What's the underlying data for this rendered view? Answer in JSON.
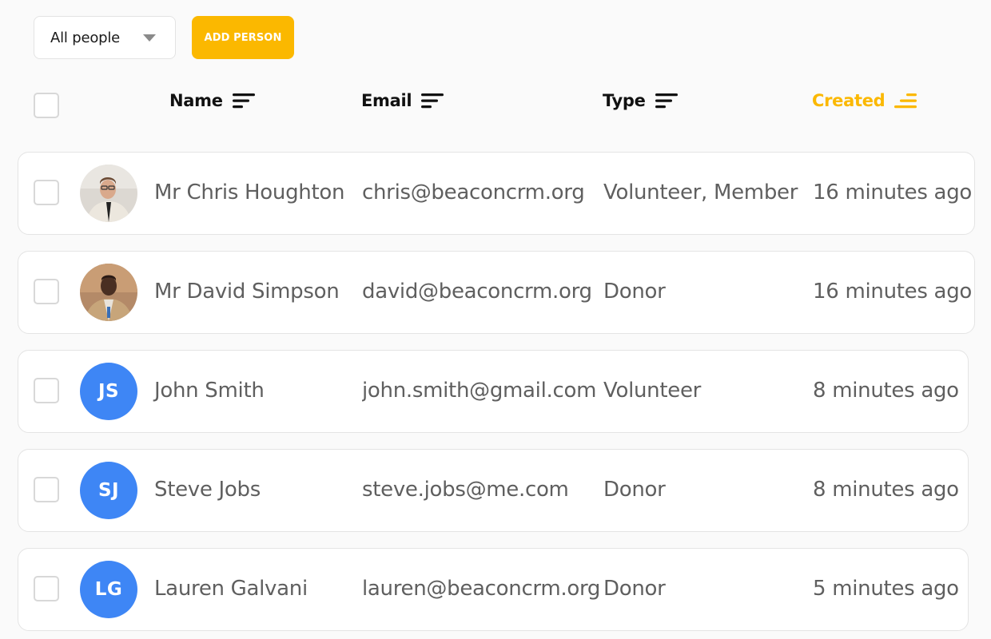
{
  "toolbar": {
    "filter_label": "All people",
    "add_button_label": "ADD PERSON"
  },
  "colors": {
    "accent": "#fbb800",
    "avatar_blue": "#3e86f5",
    "background": "#fafafa",
    "text_muted": "#5f5f5f"
  },
  "columns": {
    "name": "Name",
    "email": "Email",
    "type": "Type",
    "created": "Created",
    "sorted_by": "created"
  },
  "people": [
    {
      "name": "Mr Chris Houghton",
      "email": "chris@beaconcrm.org",
      "type": "Volunteer, Member",
      "created": "16 minutes ago",
      "avatar": "photo"
    },
    {
      "name": "Mr David Simpson",
      "email": "david@beaconcrm.org",
      "type": "Donor",
      "created": "16 minutes ago",
      "avatar": "photo"
    },
    {
      "name": "John Smith",
      "email": "john.smith@gmail.com",
      "type": "Volunteer",
      "created": "8 minutes ago",
      "avatar": "initials",
      "initials": "JS"
    },
    {
      "name": "Steve Jobs",
      "email": "steve.jobs@me.com",
      "type": "Donor",
      "created": "8 minutes ago",
      "avatar": "initials",
      "initials": "SJ"
    },
    {
      "name": "Lauren Galvani",
      "email": "lauren@beaconcrm.org",
      "type": "Donor",
      "created": "5 minutes ago",
      "avatar": "initials",
      "initials": "LG"
    }
  ]
}
